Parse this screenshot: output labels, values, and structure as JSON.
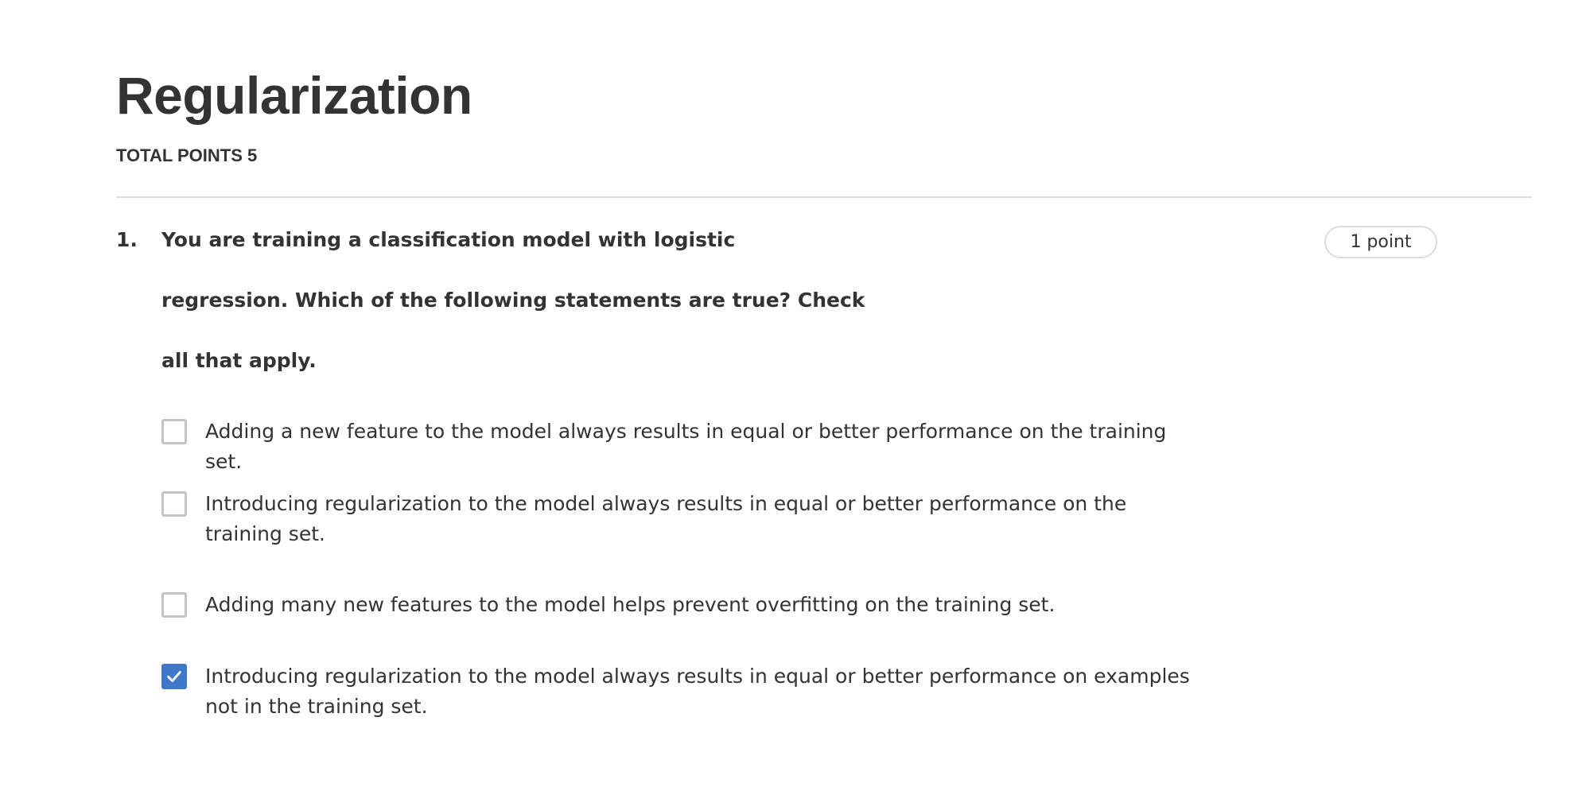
{
  "quiz": {
    "title": "Regularization",
    "total_points": "TOTAL POINTS 5"
  },
  "question": {
    "number": "1.",
    "text_lines": [
      "You are training a classification model with logistic",
      "regression. Which of the following statements are true? Check",
      "all that apply."
    ],
    "points": "1 point",
    "options": [
      {
        "text": "Adding a new feature to the model always results in equal or better performance on the training set.",
        "checked": false
      },
      {
        "text": "Introducing regularization to the model always results in equal or better performance on the training set.",
        "checked": false
      },
      {
        "text": "Adding many new features to the model helps prevent overfitting on the training set.",
        "checked": false
      },
      {
        "text": "Introducing regularization to the model always results in equal or better performance on examples not in the training set.",
        "checked": true
      }
    ]
  },
  "colors": {
    "text": "#333333",
    "checkbox_checked": "#3f78c9",
    "checkbox_border": "#c4c4c4",
    "divider": "#dcdcdc"
  },
  "icons": {
    "checkmark": "check-icon"
  }
}
